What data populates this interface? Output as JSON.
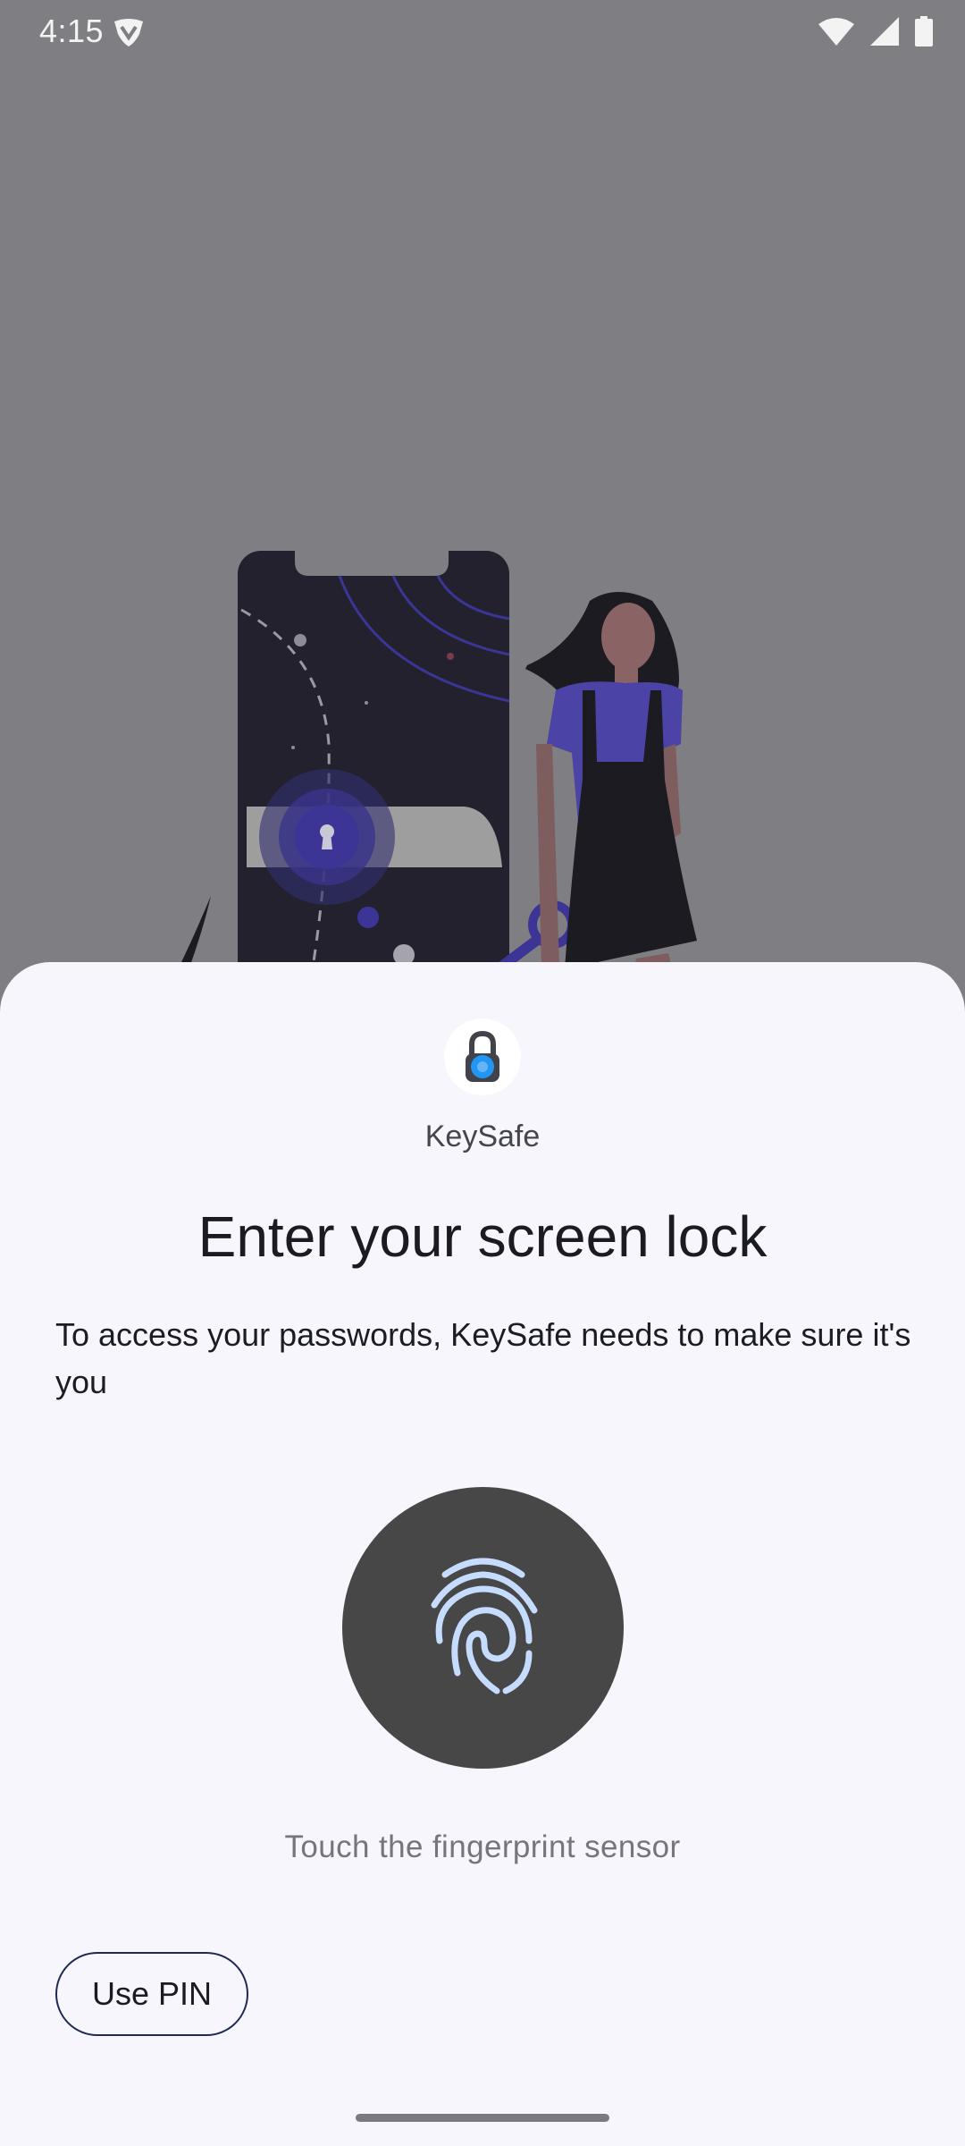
{
  "status_bar": {
    "time": "4:15",
    "icons": [
      "shield-notification-icon",
      "wifi-icon",
      "cellular-signal-icon",
      "battery-icon"
    ]
  },
  "prompt": {
    "app_name": "KeySafe",
    "app_icon": "padlock-icon",
    "title": "Enter your screen lock",
    "subtitle": "To access your passwords, KeySafe needs to make sure it's you",
    "fingerprint_icon": "fingerprint-icon",
    "fingerprint_hint": "Touch the fingerprint sensor",
    "use_pin_label": "Use PIN"
  },
  "colors": {
    "scrim": "#7f7e83",
    "sheet": "#f6f6fc",
    "fingerprint_button": "#474747",
    "fingerprint_stroke": "#c6dcff",
    "pin_outline": "#1e2a55"
  }
}
